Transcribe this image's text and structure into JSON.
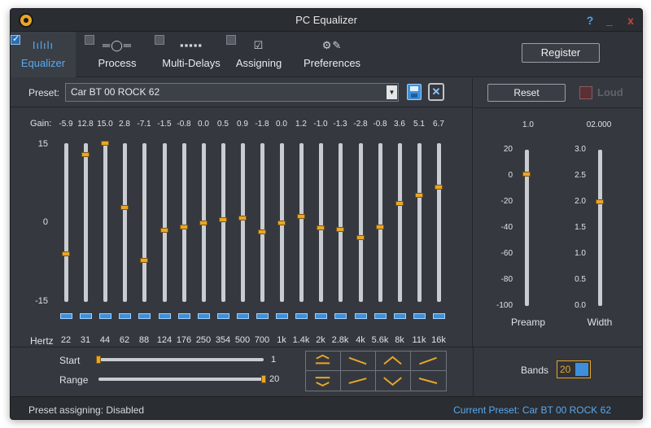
{
  "window": {
    "title": "PC Equalizer",
    "help": "?",
    "minimize": "_",
    "close": "x"
  },
  "tabs": [
    {
      "label": "Equalizer",
      "icon": "Iılılı",
      "checked": true,
      "active": true
    },
    {
      "label": "Process",
      "icon": "═◯═",
      "checked": false,
      "active": false
    },
    {
      "label": "Multi-Delays",
      "icon": "▪▪▪▪▪",
      "checked": false,
      "active": false
    },
    {
      "label": "Assigning",
      "icon": "☑",
      "checked": false,
      "active": false
    },
    {
      "label": "Preferences",
      "icon": "⚙✎",
      "checked": false,
      "active": false
    }
  ],
  "register_label": "Register",
  "preset": {
    "label": "Preset:",
    "value": "Car BT 00 ROCK 62"
  },
  "gain_label": "Gain:",
  "gains": [
    "-5.9",
    "12.8",
    "15.0",
    "2.8",
    "-7.1",
    "-1.5",
    "-0.8",
    "0.0",
    "0.5",
    "0.9",
    "-1.8",
    "0.0",
    "1.2",
    "-1.0",
    "-1.3",
    "-2.8",
    "-0.8",
    "3.6",
    "5.1",
    "6.7"
  ],
  "gain_values": [
    -5.9,
    12.8,
    15.0,
    2.8,
    -7.1,
    -1.5,
    -0.8,
    0.0,
    0.5,
    0.9,
    -1.8,
    0.0,
    1.2,
    -1.0,
    -1.3,
    -2.8,
    -0.8,
    3.6,
    5.1,
    6.7
  ],
  "gain_scale": [
    "15",
    "0",
    "-15"
  ],
  "hertz_label": "Hertz",
  "frequencies": [
    "22",
    "31",
    "44",
    "62",
    "88",
    "124",
    "176",
    "250",
    "354",
    "500",
    "700",
    "1k",
    "1.4k",
    "2k",
    "2.8k",
    "4k",
    "5.6k",
    "8k",
    "11k",
    "16k"
  ],
  "start": {
    "label": "Start",
    "value": "1",
    "level": 0.0
  },
  "range": {
    "label": "Range",
    "value": "20",
    "level": 1.0
  },
  "bands": {
    "label": "Bands",
    "value": "20"
  },
  "right": {
    "reset_label": "Reset",
    "loud_label": "Loud",
    "preamp": {
      "value": "1.0",
      "label": "Preamp",
      "scale": [
        "20",
        "0",
        "-20",
        "-40",
        "-60",
        "-80",
        "-100"
      ],
      "level": 1.0
    },
    "width": {
      "value": "02.000",
      "label": "Width",
      "scale": [
        "3.0",
        "2.5",
        "2.0",
        "1.5",
        "1.0",
        "0.5",
        "0.0"
      ],
      "level": 2.0
    }
  },
  "status": {
    "left": "Preset assigning:  Disabled",
    "right": "Current Preset: Car BT 00 ROCK 62"
  }
}
